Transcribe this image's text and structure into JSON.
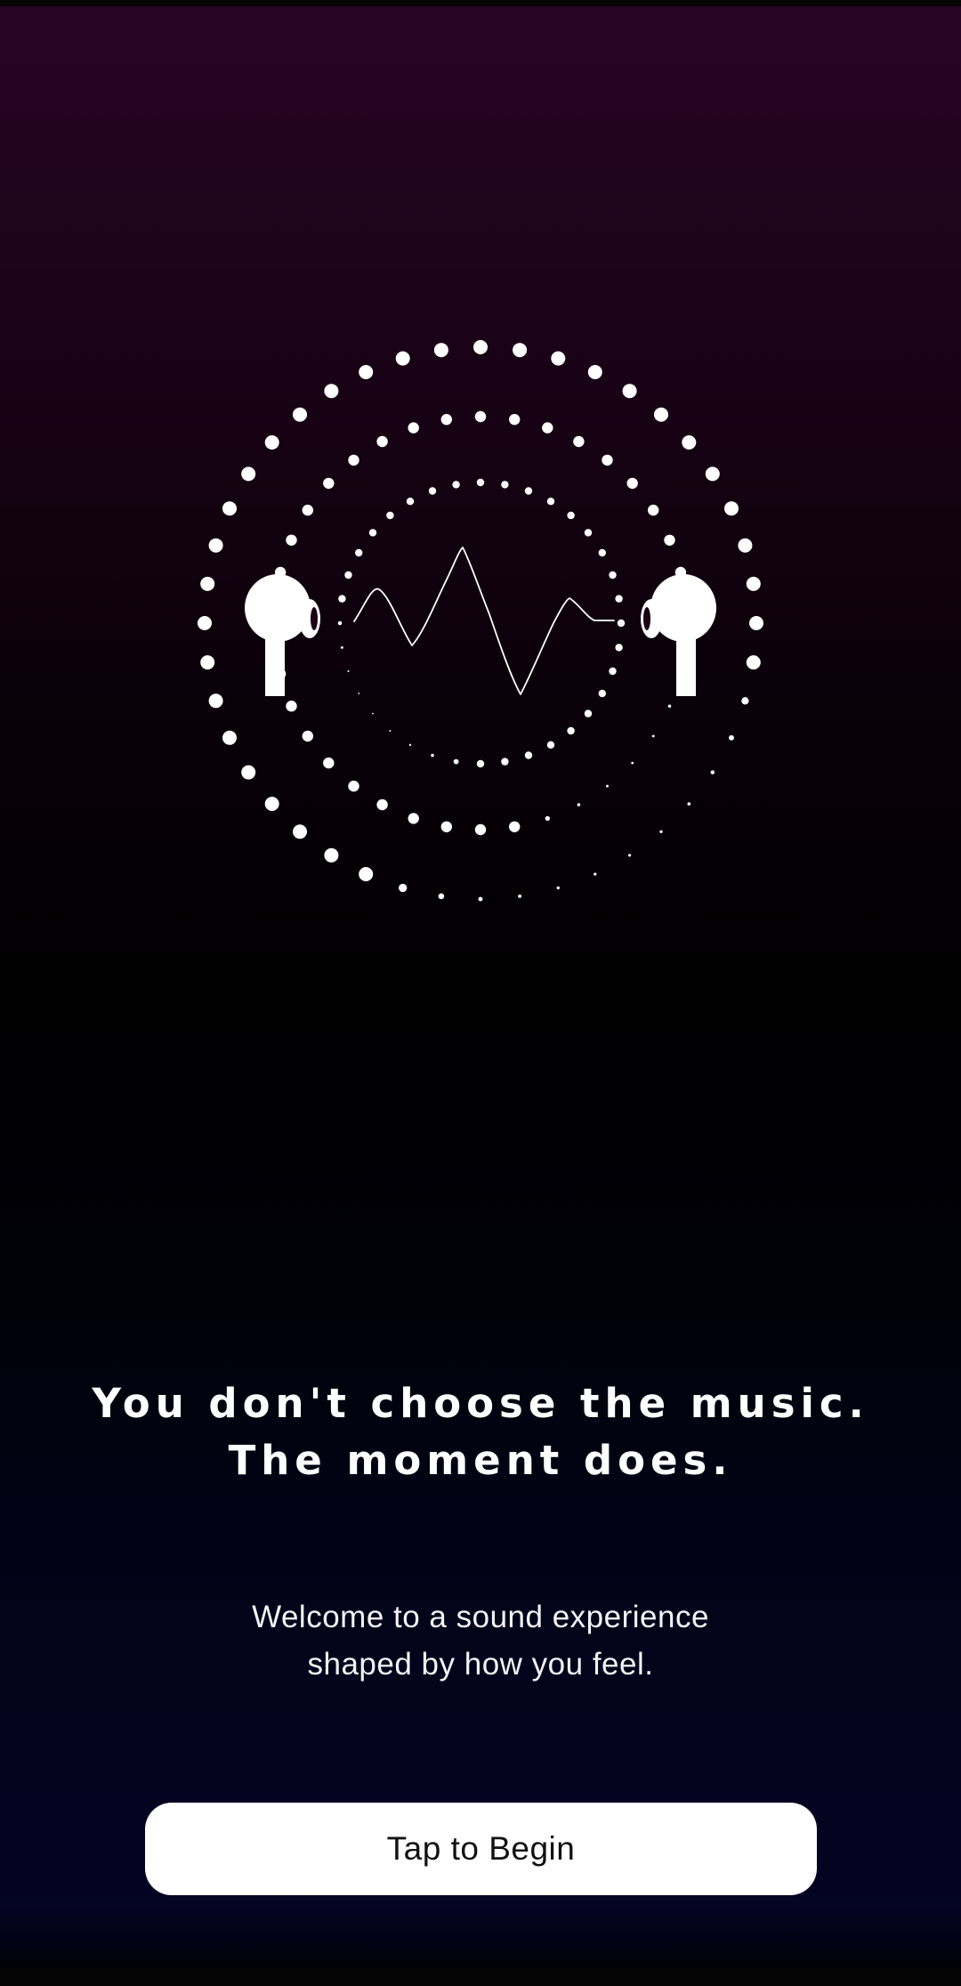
{
  "headline": {
    "line1": "You don't choose the music.",
    "line2": "The moment does."
  },
  "subtitle": {
    "line1": "Welcome to a sound experience",
    "line2": "shaped by how you feel."
  },
  "cta": {
    "label": "Tap to Begin"
  },
  "icons": {
    "left_earbud": "earbud-icon",
    "right_earbud": "earbud-icon",
    "waveform": "sound-wave-icon"
  },
  "colors": {
    "background_top": "#280524",
    "background_mid": "#000000",
    "background_bottom": "#040423",
    "foreground": "#ffffff",
    "button_bg": "#ffffff",
    "button_text": "#111111"
  }
}
